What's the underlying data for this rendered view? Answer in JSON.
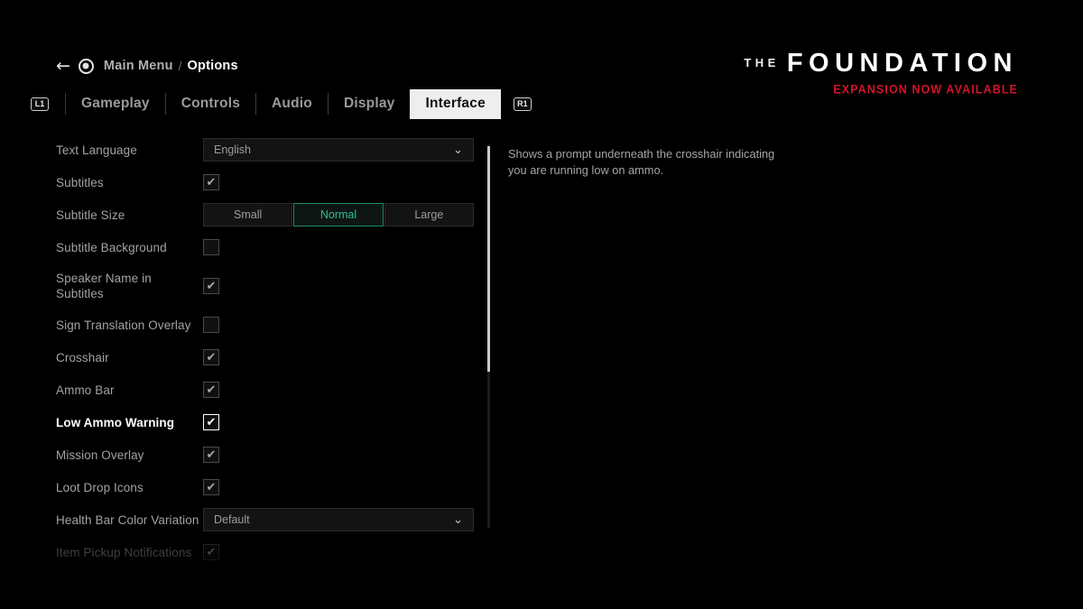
{
  "breadcrumb": {
    "back_icon": "arrow-left-icon",
    "button_icon": "circle-button-icon",
    "parent": "Main Menu",
    "separator": "/",
    "current": "Options"
  },
  "logo": {
    "prefix": "THE",
    "title": "FOUNDATION",
    "subtitle": "EXPANSION NOW AVAILABLE",
    "accent_color": "#d0142a"
  },
  "tabs": {
    "left_shoulder": "L1",
    "right_shoulder": "R1",
    "items": [
      {
        "label": "Gameplay",
        "selected": false
      },
      {
        "label": "Controls",
        "selected": false
      },
      {
        "label": "Audio",
        "selected": false
      },
      {
        "label": "Display",
        "selected": false
      },
      {
        "label": "Interface",
        "selected": true
      }
    ]
  },
  "settings": {
    "rows": [
      {
        "label": "Text Language",
        "type": "dropdown",
        "value": "English"
      },
      {
        "label": "Subtitles",
        "type": "checkbox",
        "value": "checked"
      },
      {
        "label": "Subtitle Size",
        "type": "segmented",
        "options": [
          "Small",
          "Normal",
          "Large"
        ],
        "value": "Normal"
      },
      {
        "label": "Subtitle Background",
        "type": "checkbox",
        "value": "unchecked"
      },
      {
        "label": "Speaker Name in Subtitles",
        "type": "checkbox",
        "value": "checked"
      },
      {
        "label": "Sign Translation Overlay",
        "type": "checkbox",
        "value": "unchecked"
      },
      {
        "label": "Crosshair",
        "type": "checkbox",
        "value": "checked"
      },
      {
        "label": "Ammo Bar",
        "type": "checkbox",
        "value": "checked"
      },
      {
        "label": "Low Ammo Warning",
        "type": "checkbox",
        "value": "checked",
        "focused": true
      },
      {
        "label": "Mission Overlay",
        "type": "checkbox",
        "value": "checked"
      },
      {
        "label": "Loot Drop Icons",
        "type": "checkbox",
        "value": "checked"
      },
      {
        "label": "Health Bar Color Variation",
        "type": "dropdown",
        "value": "Default"
      },
      {
        "label": "Item Pickup Notifications",
        "type": "checkbox",
        "value": "checked"
      },
      {
        "label": "Weapon Swap Prompt",
        "type": "checkbox",
        "value": "checked"
      }
    ],
    "checkmark_glyph": "✔",
    "chevron_glyph": "⌄",
    "accent_color": "#2fbf97"
  },
  "description": {
    "text": "Shows a prompt underneath the crosshair indicating you are running low on ammo."
  }
}
